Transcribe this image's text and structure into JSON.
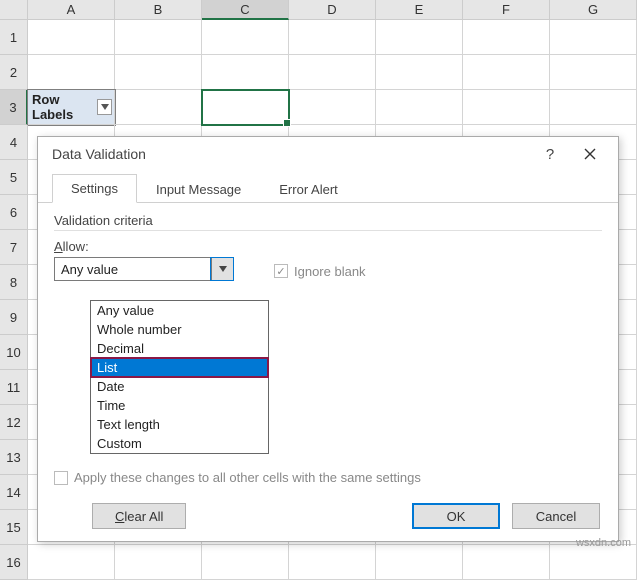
{
  "columns": [
    "A",
    "B",
    "C",
    "D",
    "E",
    "F",
    "G"
  ],
  "rows": [
    "1",
    "2",
    "3",
    "4",
    "5",
    "6",
    "7",
    "8",
    "9",
    "10",
    "11",
    "12",
    "13",
    "14",
    "15",
    "16"
  ],
  "selected_cell": "C3",
  "a3_cell": {
    "label": "Row Labels"
  },
  "dialog": {
    "title": "Data Validation",
    "tabs": {
      "settings": "Settings",
      "input_message": "Input Message",
      "error_alert": "Error Alert"
    },
    "group": "Validation criteria",
    "allow_label": "Allow:",
    "allow_value": "Any value",
    "allow_options": [
      "Any value",
      "Whole number",
      "Decimal",
      "List",
      "Date",
      "Time",
      "Text length",
      "Custom"
    ],
    "allow_selected_option": "List",
    "ignore_blank": "Ignore blank",
    "apply_text": "Apply these changes to all other cells with the same settings",
    "buttons": {
      "clear_all": "Clear All",
      "ok": "OK",
      "cancel": "Cancel"
    }
  },
  "watermark": "wsxdn.com"
}
